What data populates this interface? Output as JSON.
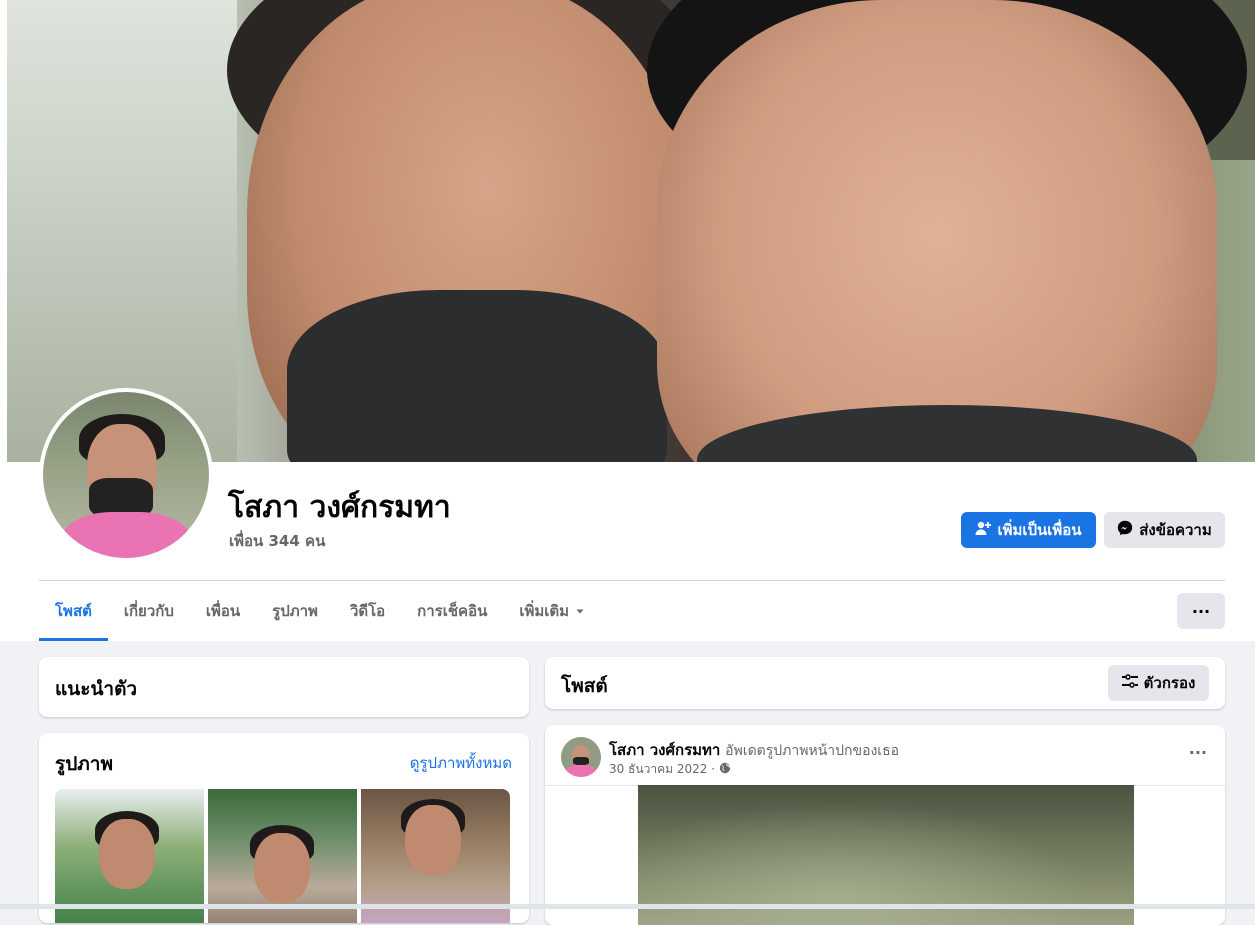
{
  "profile": {
    "name": "โสภา วงศ์กรมทา",
    "friends": "เพื่อน 344 คน"
  },
  "actions": {
    "add_friend": "เพิ่มเป็นเพื่อน",
    "message": "ส่งข้อความ",
    "more": "···"
  },
  "tabs": [
    {
      "label": "โพสต์",
      "active": true
    },
    {
      "label": "เกี่ยวกับ"
    },
    {
      "label": "เพื่อน"
    },
    {
      "label": "รูปภาพ"
    },
    {
      "label": "วิดีโอ"
    },
    {
      "label": "การเช็คอิน"
    },
    {
      "label": "เพิ่มเติม"
    }
  ],
  "intro": {
    "title": "แนะนำตัว"
  },
  "photos": {
    "title": "รูปภาพ",
    "see_all": "ดูรูปภาพทั้งหมด"
  },
  "posts": {
    "title": "โพสต์",
    "filter": "ตัวกรอง",
    "items": [
      {
        "author": "โสภา วงศ์กรมทา",
        "action": "อัพเดตรูปภาพหน้าปกของเธอ",
        "date": "30 ธันวาคม 2022 ·",
        "menu": "···"
      }
    ]
  },
  "colors": {
    "accent": "#1b74e4",
    "bg": "#f0f2f5",
    "button_gray": "#e4e6eb"
  },
  "icons": [
    "add-friend-icon",
    "messenger-icon",
    "caret-down-icon",
    "filter-icon",
    "globe-icon",
    "more-icon"
  ]
}
